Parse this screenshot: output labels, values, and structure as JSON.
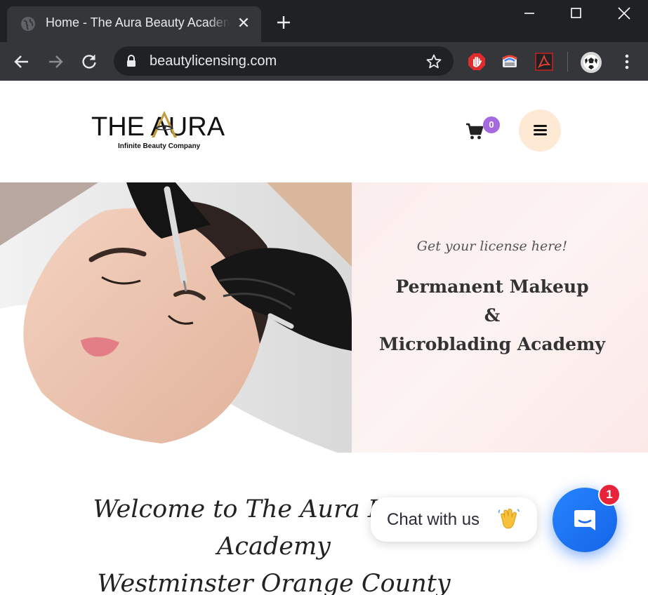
{
  "browser": {
    "tab_title": "Home - The Aura Beauty Academy",
    "tab_close_icon": "close-icon",
    "new_tab_symbol": "+",
    "url": "beautylicensing.com",
    "extensions": [
      "adblock-icon",
      "screenshot-extension-icon",
      "pdf-extension-icon"
    ]
  },
  "header": {
    "logo_text": "THE AURA",
    "logo_tagline": "Infinite Beauty Company",
    "cart_count": "0",
    "accent_color": "#a56ae0",
    "menu_button_color": "#fde9d4"
  },
  "hero": {
    "tagline": "Get your license here!",
    "title_lines": [
      "Permanent Makeup",
      "&",
      "Microblading Academy"
    ]
  },
  "welcome": {
    "line1": "Welcome to The Aura Beauty Academy",
    "line2": "Westminster Orange County"
  },
  "chat": {
    "prompt": "Chat with us",
    "unread_count": "1",
    "launcher_color": "#1b6bf4"
  }
}
